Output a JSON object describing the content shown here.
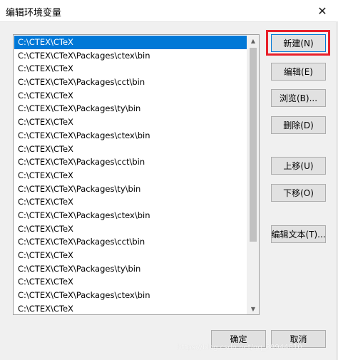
{
  "window": {
    "title": "编辑环境变量",
    "close_glyph": "✕"
  },
  "list": {
    "items": [
      "C:\\CTEX\\CTeX",
      "C:\\CTEX\\CTeX\\Packages\\ctex\\bin",
      "C:\\CTEX\\CTeX",
      "C:\\CTEX\\CTeX\\Packages\\cct\\bin",
      "C:\\CTEX\\CTeX",
      "C:\\CTEX\\CTeX\\Packages\\ty\\bin",
      "C:\\CTEX\\CTeX",
      "C:\\CTEX\\CTeX\\Packages\\ctex\\bin",
      "C:\\CTEX\\CTeX",
      "C:\\CTEX\\CTeX\\Packages\\cct\\bin",
      "C:\\CTEX\\CTeX",
      "C:\\CTEX\\CTeX\\Packages\\ty\\bin",
      "C:\\CTEX\\CTeX",
      "C:\\CTEX\\CTeX\\Packages\\ctex\\bin",
      "C:\\CTEX\\CTeX",
      "C:\\CTEX\\CTeX\\Packages\\cct\\bin",
      "C:\\CTEX\\CTeX",
      "C:\\CTEX\\CTeX\\Packages\\ty\\bin",
      "C:\\CTEX\\CTeX",
      "C:\\CTEX\\CTeX\\Packages\\ctex\\bin",
      "C:\\CTEX\\CTeX"
    ],
    "selected_index": 0,
    "scroll_up_glyph": "▲",
    "scroll_down_glyph": "▼"
  },
  "buttons": {
    "new": "新建(N)",
    "edit": "编辑(E)",
    "browse": "浏览(B)...",
    "delete": "删除(D)",
    "move_up": "上移(U)",
    "move_down": "下移(O)",
    "edit_text": "编辑文本(T)...",
    "ok": "确定",
    "cancel": "取消"
  },
  "watermark": "https://blog.csdn.net/qq_39944810",
  "colors": {
    "selection": "#0078d7",
    "highlight": "#e8202a"
  }
}
